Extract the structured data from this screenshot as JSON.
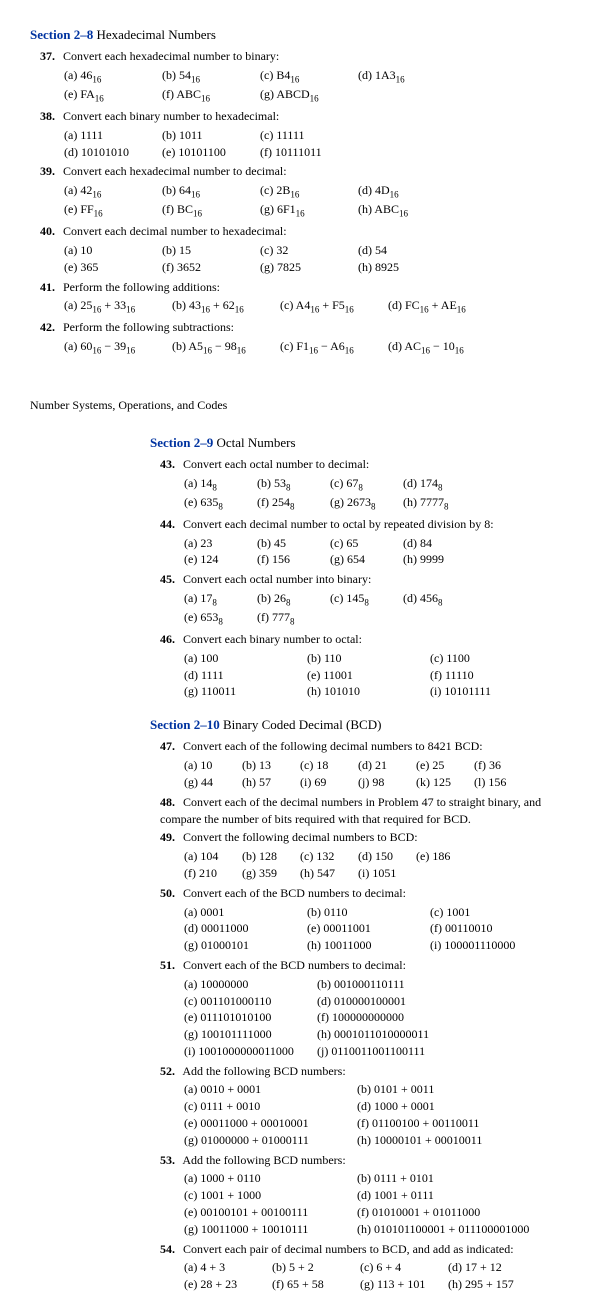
{
  "sec28": {
    "title_blue": "Section 2–8",
    "title_black": "Hexadecimal Numbers",
    "q37": {
      "num": "37.",
      "text": "Convert each hexadecimal number to binary:",
      "a": "(a) 46₁₆",
      "b": "(b) 54₁₆",
      "c": "(c) B4₁₆",
      "d": "(d) 1A3₁₆",
      "e": "(e) FA₁₆",
      "f": "(f) ABC₁₆",
      "g": "(g) ABCD₁₆"
    },
    "q38": {
      "num": "38.",
      "text": "Convert each binary number to hexadecimal:",
      "a": "(a) 1111",
      "b": "(b) 1011",
      "c": "(c) 11111",
      "d": "(d) 10101010",
      "e": "(e) 10101100",
      "f": "(f) 10111011"
    },
    "q39": {
      "num": "39.",
      "text": "Convert each hexadecimal number to decimal:",
      "a": "(a) 42₁₆",
      "b": "(b) 64₁₆",
      "c": "(c) 2B₁₆",
      "d": "(d) 4D₁₆",
      "e": "(e) FF₁₆",
      "f": "(f) BC₁₆",
      "g": "(g) 6F1₁₆",
      "h": "(h) ABC₁₆"
    },
    "q40": {
      "num": "40.",
      "text": "Convert each decimal number to hexadecimal:",
      "a": "(a) 10",
      "b": "(b) 15",
      "c": "(c) 32",
      "d": "(d) 54",
      "e": "(e) 365",
      "f": "(f) 3652",
      "g": "(g) 7825",
      "h": "(h) 8925"
    },
    "q41": {
      "num": "41.",
      "text": "Perform the following additions:",
      "a": "(a) 25₁₆ + 33₁₆",
      "b": "(b) 43₁₆ + 62₁₆",
      "c": "(c) A4₁₆ + F5₁₆",
      "d": "(d) FC₁₆ + AE₁₆"
    },
    "q42": {
      "num": "42.",
      "text": "Perform the following subtractions:",
      "a": "(a) 60₁₆ − 39₁₆",
      "b": "(b) A5₁₆ − 98₁₆",
      "c": "(c) F1₁₆ − A6₁₆",
      "d": "(d) AC₁₆ − 10₁₆"
    }
  },
  "chapter": "Number Systems, Operations, and Codes",
  "sec29": {
    "title_blue": "Section 2–9",
    "title_black": "Octal Numbers",
    "q43": {
      "num": "43.",
      "text": "Convert each octal number to decimal:",
      "a": "(a) 14₈",
      "b": "(b) 53₈",
      "c": "(c) 67₈",
      "d": "(d) 174₈",
      "e": "(e) 635₈",
      "f": "(f) 254₈",
      "g": "(g) 2673₈",
      "h": "(h) 7777₈"
    },
    "q44": {
      "num": "44.",
      "text": "Convert each decimal number to octal by repeated division by 8:",
      "a": "(a) 23",
      "b": "(b) 45",
      "c": "(c) 65",
      "d": "(d) 84",
      "e": "(e) 124",
      "f": "(f) 156",
      "g": "(g) 654",
      "h": "(h) 9999"
    },
    "q45": {
      "num": "45.",
      "text": "Convert each octal number into binary:",
      "a": "(a) 17₈",
      "b": "(b) 26₈",
      "c": "(c) 145₈",
      "d": "(d) 456₈",
      "e": "(e) 653₈",
      "f": "(f) 777₈"
    },
    "q46": {
      "num": "46.",
      "text": "Convert each binary number to octal:",
      "a": "(a) 100",
      "b": "(b) 110",
      "c": "(c) 1100",
      "d": "(d) 1111",
      "e": "(e) 11001",
      "f": "(f) 11110",
      "g": "(g) 110011",
      "h": "(h) 101010",
      "i": "(i) 10101111"
    }
  },
  "sec210": {
    "title_blue": "Section 2–10",
    "title_black": "Binary Coded Decimal (BCD)",
    "q47": {
      "num": "47.",
      "text": "Convert each of the following decimal numbers to 8421 BCD:",
      "a": "(a) 10",
      "b": "(b) 13",
      "c": "(c) 18",
      "d": "(d) 21",
      "e": "(e) 25",
      "f": "(f) 36",
      "g": "(g) 44",
      "h": "(h) 57",
      "i": "(i) 69",
      "j": "(j) 98",
      "k": "(k) 125",
      "l": "(l) 156"
    },
    "q48": {
      "num": "48.",
      "text": "Convert each of the decimal numbers in Problem 47 to straight binary, and compare the number of bits required with that required for BCD."
    },
    "q49": {
      "num": "49.",
      "text": "Convert the following decimal numbers to BCD:",
      "a": "(a) 104",
      "b": "(b) 128",
      "c": "(c) 132",
      "d": "(d) 150",
      "e": "(e) 186",
      "f": "(f) 210",
      "g": "(g) 359",
      "h": "(h) 547",
      "i": "(i) 1051"
    },
    "q50": {
      "num": "50.",
      "text": "Convert each of the BCD numbers to decimal:",
      "a": "(a) 0001",
      "b": "(b) 0110",
      "c": "(c) 1001",
      "d": "(d) 00011000",
      "e": "(e) 00011001",
      "f": "(f) 00110010",
      "g": "(g) 01000101",
      "h": "(h) 10011000",
      "i": "(i) 100001110000"
    },
    "q51": {
      "num": "51.",
      "text": "Convert each of the BCD numbers to decimal:",
      "a": "(a) 10000000",
      "b": "(b) 001000110111",
      "c": "(c) 001101000110",
      "d": "(d) 010000100001",
      "e": "(e) 011101010100",
      "f": "(f) 100000000000",
      "g": "(g) 100101111000",
      "h": "(h) 0001011010000011",
      "i": "(i) 1001000000011000",
      "j": "(j) 0110011001100111"
    },
    "q52": {
      "num": "52.",
      "text": "Add the following BCD numbers:",
      "a": "(a) 0010 + 0001",
      "b": "(b) 0101 + 0011",
      "c": "(c) 0111 + 0010",
      "d": "(d) 1000 + 0001",
      "e": "(e) 00011000 + 00010001",
      "f": "(f) 01100100 + 00110011",
      "g": "(g) 01000000 + 01000111",
      "h": "(h) 10000101 + 00010011"
    },
    "q53": {
      "num": "53.",
      "text": "Add the following BCD numbers:",
      "a": "(a) 1000 + 0110",
      "b": "(b) 0111 + 0101",
      "c": "(c) 1001 + 1000",
      "d": "(d) 1001 + 0111",
      "e": "(e) 00100101 + 00100111",
      "f": "(f) 01010001 + 01011000",
      "g": "(g) 10011000 + 10010111",
      "h": "(h) 010101100001 + 011100001000"
    },
    "q54": {
      "num": "54.",
      "text": "Convert each pair of decimal numbers to BCD, and add as indicated:",
      "a": "(a) 4 + 3",
      "b": "(b) 5 + 2",
      "c": "(c) 6 + 4",
      "d": "(d) 17 + 12",
      "e": "(e) 28 + 23",
      "f": "(f) 65 + 58",
      "g": "(g) 113 + 101",
      "h": "(h) 295 + 157"
    }
  }
}
